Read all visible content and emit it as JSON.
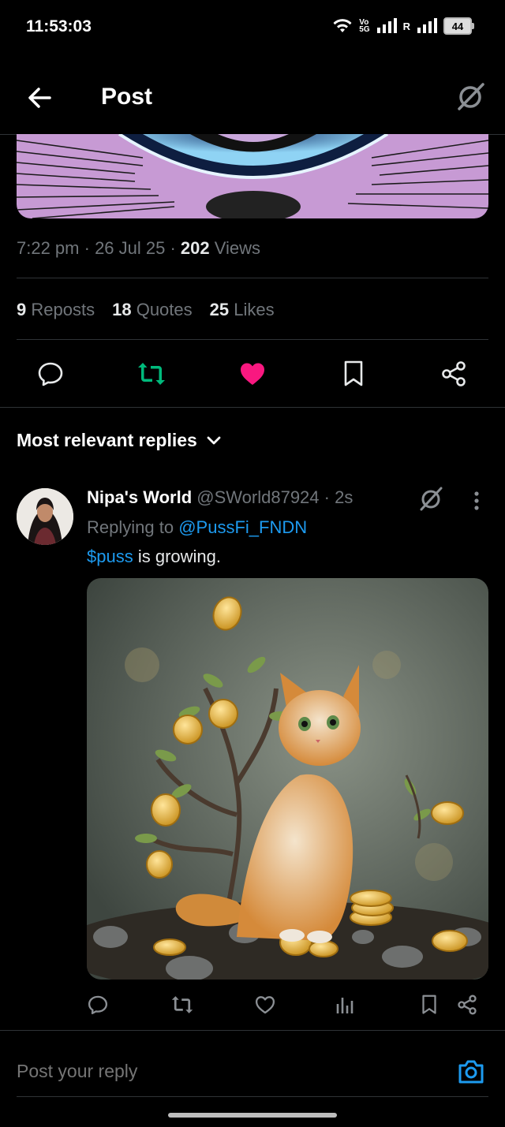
{
  "status_bar": {
    "time": "11:53:03",
    "network_top": "Vo",
    "network_bottom": "5G",
    "roaming": "R",
    "battery": "44"
  },
  "header": {
    "title": "Post"
  },
  "post": {
    "time": "7:22 pm",
    "date": "26 Jul 25",
    "views_count": "202",
    "views_label": "Views",
    "reposts_count": "9",
    "reposts_label": "Reposts",
    "quotes_count": "18",
    "quotes_label": "Quotes",
    "likes_count": "25",
    "likes_label": "Likes"
  },
  "replies": {
    "filter_label": "Most relevant replies",
    "items": [
      {
        "name": "Nipa's World",
        "handle": "@SWorld87924",
        "age": "2s",
        "replying_prefix": "Replying to",
        "replying_handle": "@PussFi_FNDN",
        "cashtag": "$puss",
        "text": " is growing."
      }
    ]
  },
  "composer": {
    "placeholder": "Post your reply"
  },
  "colors": {
    "accent": "#1d9bf0",
    "retweet": "#00ba7c",
    "like": "#f91880",
    "muted": "#71767b"
  }
}
